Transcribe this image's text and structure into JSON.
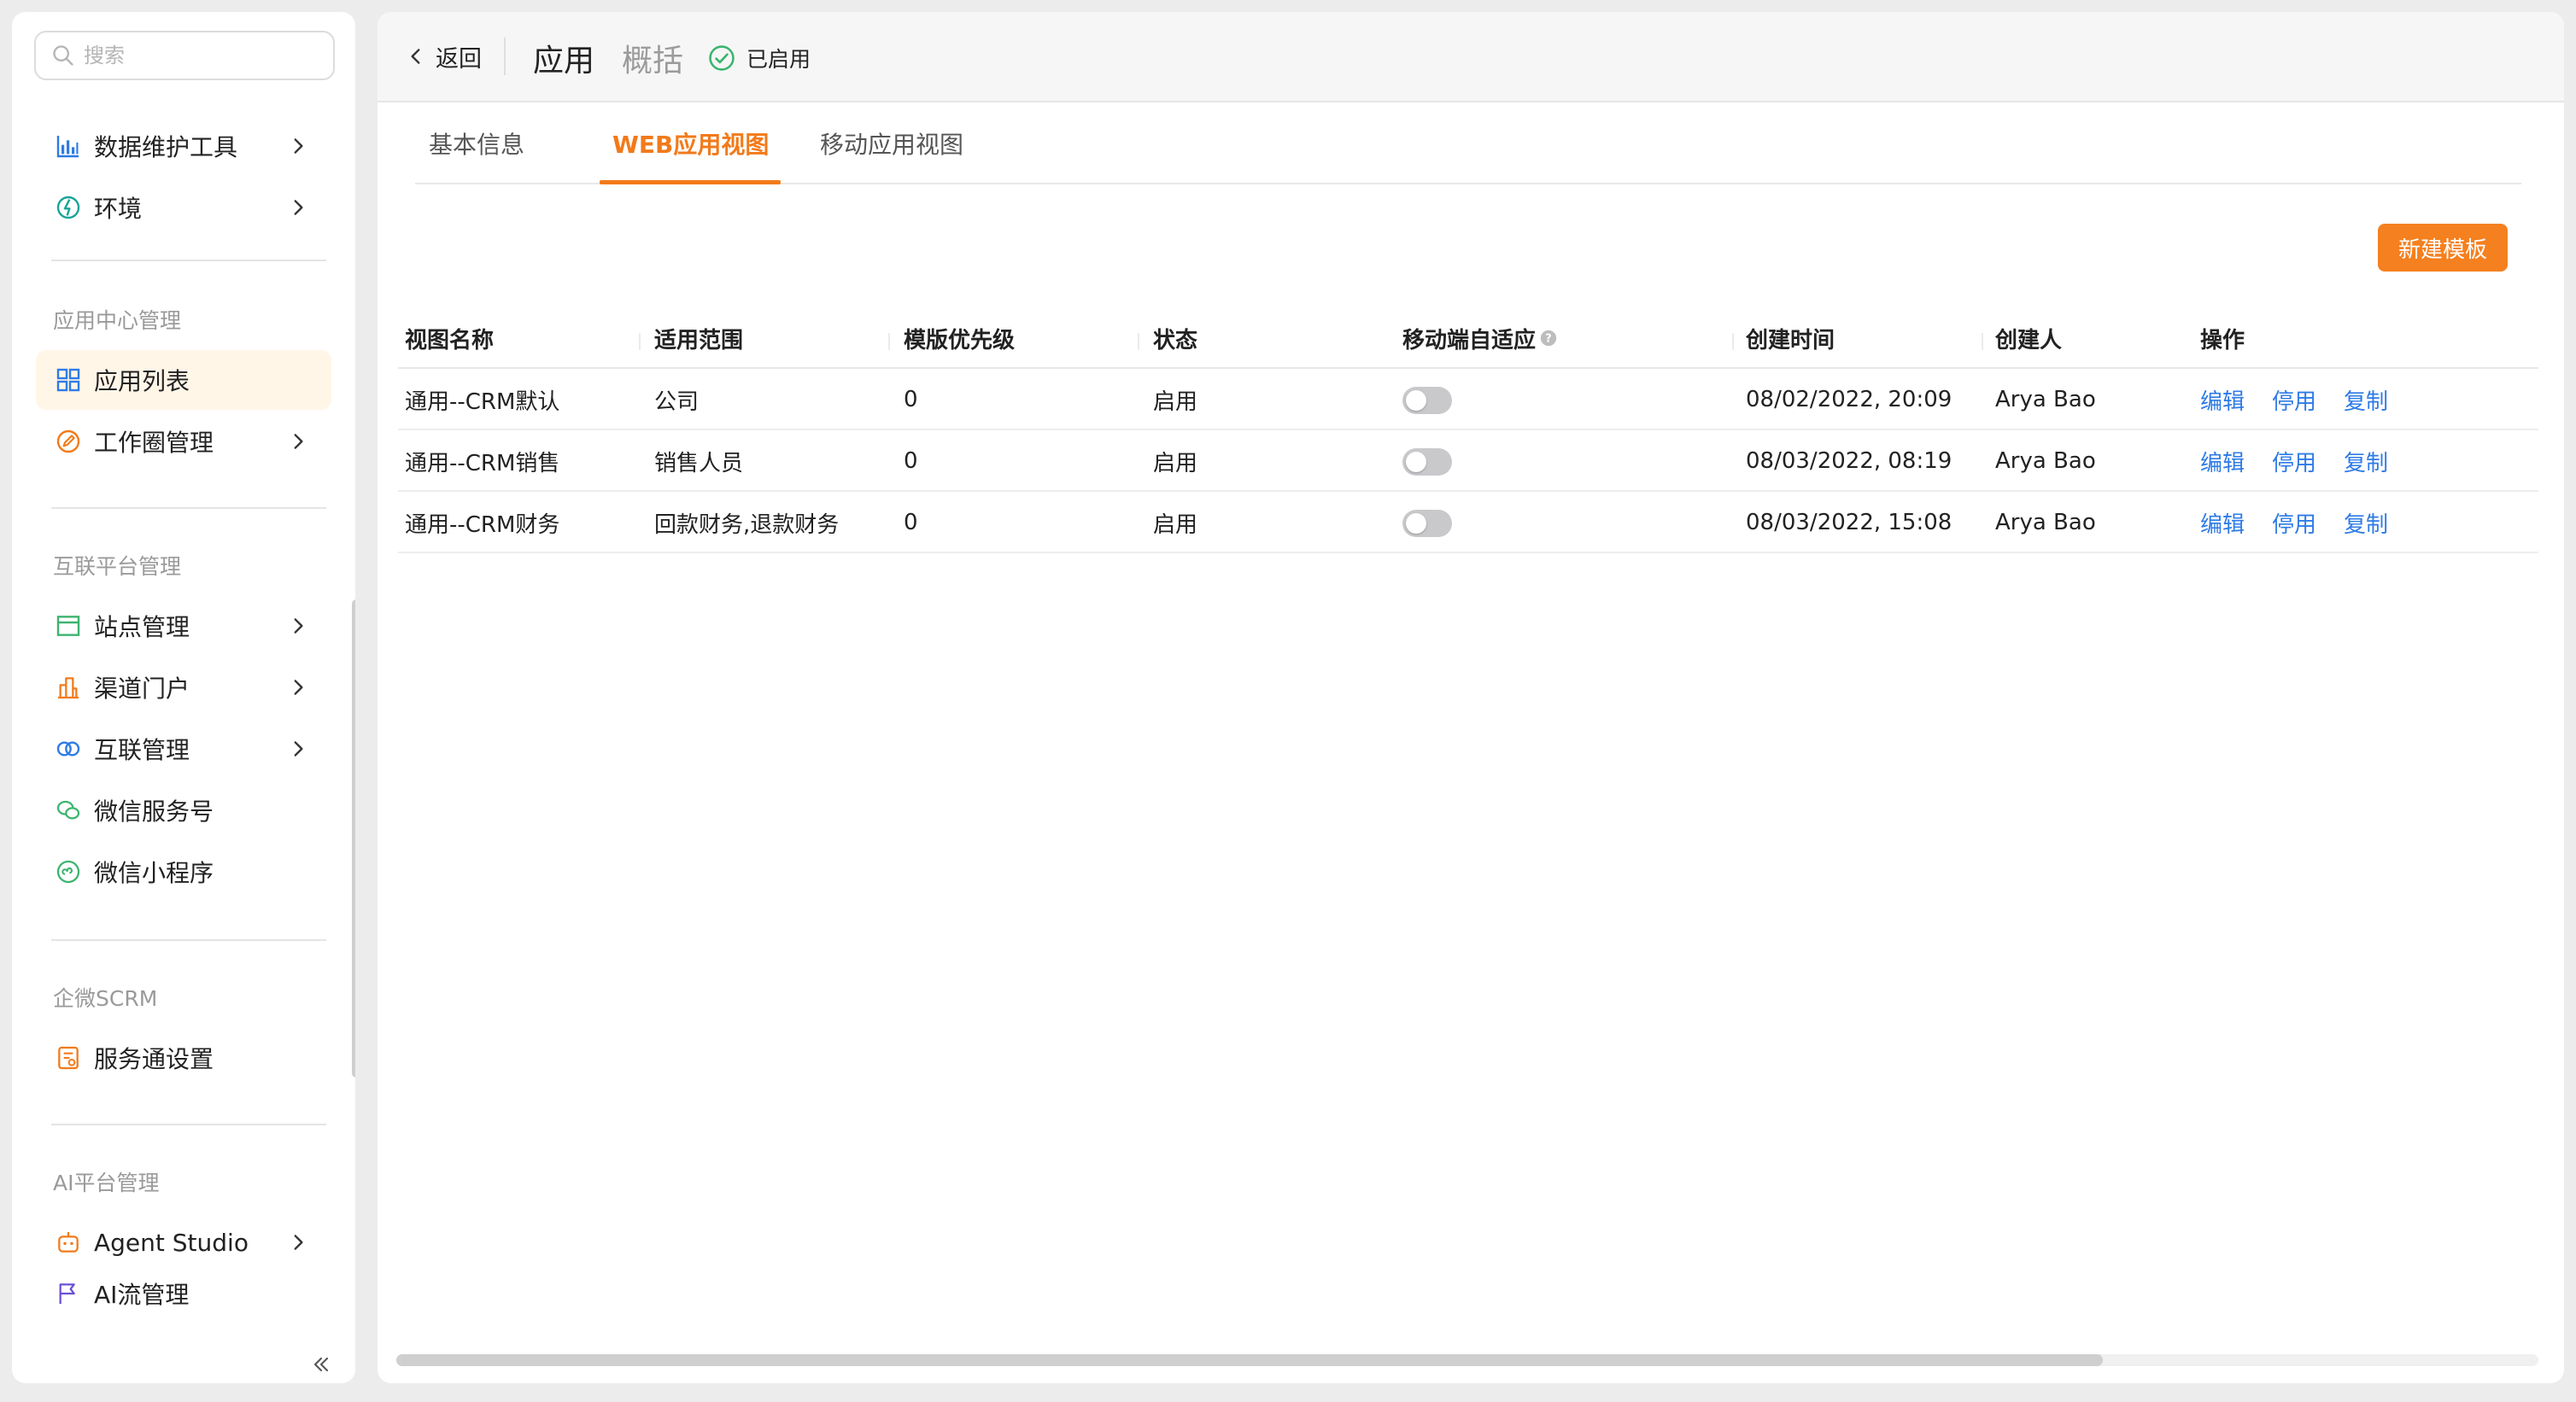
{
  "colors": {
    "accent": "#f27a1a",
    "button": "#f5801f",
    "link": "#2e7be5",
    "active_bg": "#fff6e8",
    "status_green": "#3cb46e",
    "toggle_off": "#c9c9cc"
  },
  "sidebar": {
    "search": {
      "placeholder": "搜索"
    },
    "items_top": [
      {
        "label": "数据维护工具",
        "icon": "bar-chart-icon",
        "has_chevron": true
      },
      {
        "label": "环境",
        "icon": "environment-icon",
        "has_chevron": true
      }
    ],
    "sections": [
      {
        "title": "应用中心管理",
        "items": [
          {
            "label": "应用列表",
            "icon": "grid-icon",
            "active": true,
            "has_chevron": false
          },
          {
            "label": "工作圈管理",
            "icon": "edit-circle-icon",
            "has_chevron": true
          }
        ]
      },
      {
        "title": "互联平台管理",
        "items": [
          {
            "label": "站点管理",
            "icon": "site-icon",
            "has_chevron": true
          },
          {
            "label": "渠道门户",
            "icon": "buildings-icon",
            "has_chevron": true
          },
          {
            "label": "互联管理",
            "icon": "link-rings-icon",
            "has_chevron": true
          },
          {
            "label": "微信服务号",
            "icon": "wechat-icon",
            "has_chevron": false
          },
          {
            "label": "微信小程序",
            "icon": "mini-program-icon",
            "has_chevron": false
          }
        ]
      },
      {
        "title": "企微SCRM",
        "items": [
          {
            "label": "服务通设置",
            "icon": "service-settings-icon",
            "has_chevron": false
          }
        ]
      },
      {
        "title": "AI平台管理",
        "items": [
          {
            "label": "Agent Studio",
            "icon": "robot-icon",
            "has_chevron": true
          },
          {
            "label": "AI流管理",
            "icon": "flag-icon",
            "has_chevron": false
          }
        ]
      }
    ]
  },
  "header": {
    "back_label": "返回",
    "title": "应用",
    "subtitle": "概括",
    "status_label": "已启用"
  },
  "tabs": [
    {
      "label": "基本信息",
      "active": false
    },
    {
      "label": "WEB应用视图",
      "active": true
    },
    {
      "label": "移动应用视图",
      "active": false
    }
  ],
  "new_template_label": "新建模板",
  "table": {
    "columns": [
      "视图名称",
      "适用范围",
      "模版优先级",
      "状态",
      "移动端自适应",
      "创建时间",
      "创建人",
      "操作"
    ],
    "rows": [
      {
        "name": "通用--CRM默认",
        "scope": "公司",
        "priority": "0",
        "status": "启用",
        "mobile_adaptive": false,
        "created_at": "08/02/2022, 20:09",
        "creator": "Arya Bao"
      },
      {
        "name": "通用--CRM销售",
        "scope": "销售人员",
        "priority": "0",
        "status": "启用",
        "mobile_adaptive": false,
        "created_at": "08/03/2022, 08:19",
        "creator": "Arya Bao"
      },
      {
        "name": "通用--CRM财务",
        "scope": "回款财务,退款财务",
        "priority": "0",
        "status": "启用",
        "mobile_adaptive": false,
        "created_at": "08/03/2022, 15:08",
        "creator": "Arya Bao"
      }
    ],
    "actions": [
      "编辑",
      "停用",
      "复制"
    ]
  }
}
